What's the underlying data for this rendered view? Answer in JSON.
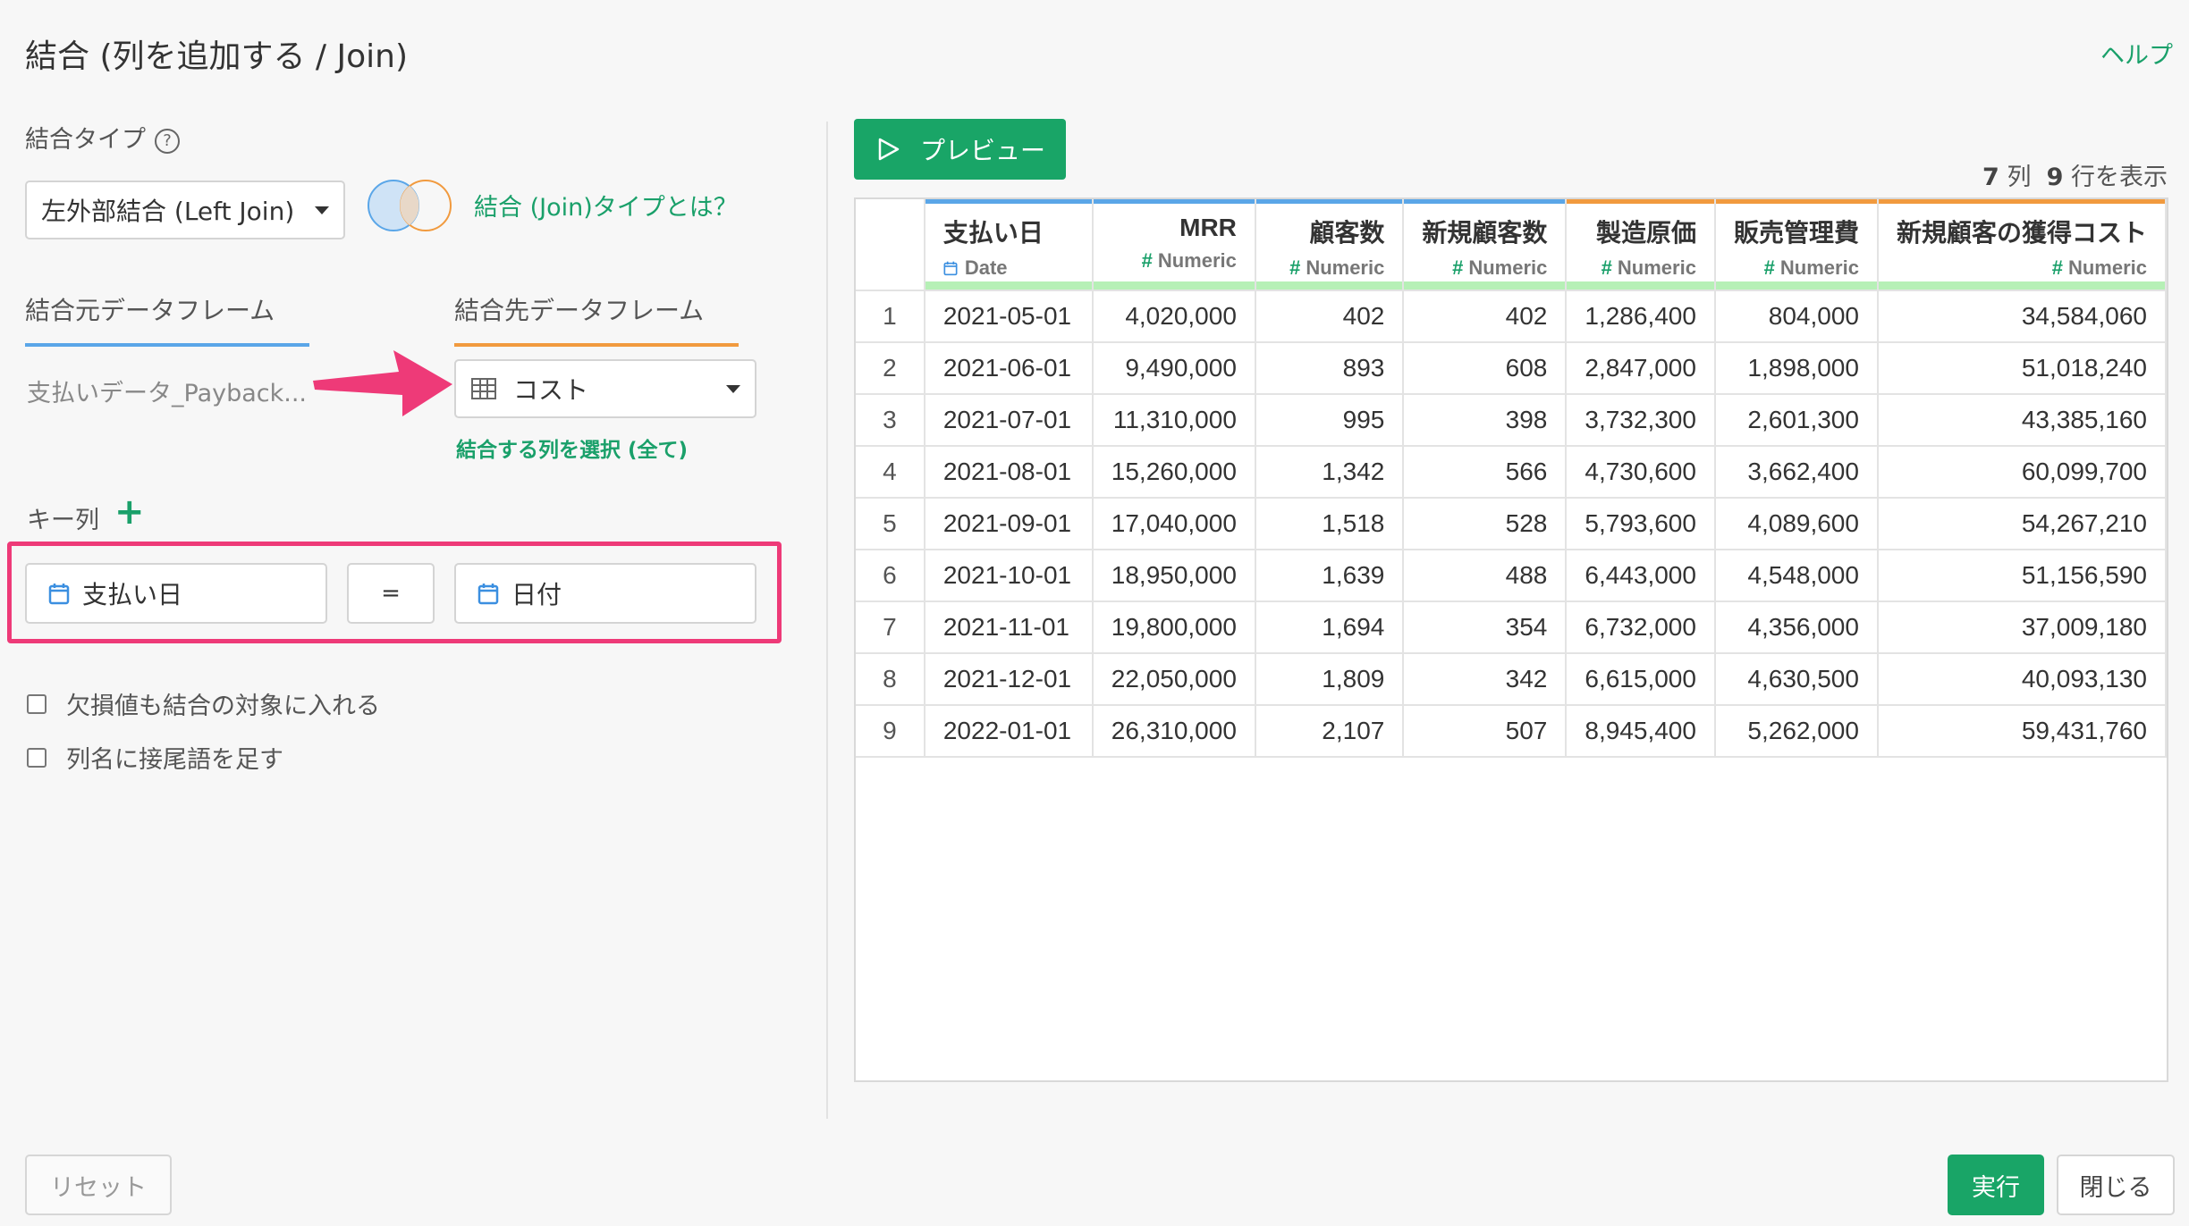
{
  "dialog": {
    "title": "結合 (列を追加する / Join)",
    "help": "ヘルプ"
  },
  "join_type": {
    "label": "結合タイプ",
    "help_icon": "?",
    "selected": "左外部結合 (Left Join)",
    "link": "結合 (Join)タイプとは？"
  },
  "source": {
    "label": "結合元データフレーム",
    "name": "支払いデータ_Payback..."
  },
  "target": {
    "label": "結合先データフレーム",
    "selected": "コスト",
    "column_link": "結合する列を選択 (全て)"
  },
  "keys": {
    "label": "キー列",
    "add": "+",
    "left": "支払い日",
    "operator": "=",
    "right": "日付"
  },
  "options": {
    "include_missing": "欠損値も結合の対象に入れる",
    "add_suffix": "列名に接尾語を足す"
  },
  "preview": {
    "button": "プレビュー",
    "cols": "7",
    "cols_unit": "列",
    "rows": "9",
    "rows_unit": "行を表示"
  },
  "table": {
    "columns": [
      {
        "name": "支払い日",
        "type": "Date",
        "color": "#5aa6e8"
      },
      {
        "name": "MRR",
        "type": "Numeric",
        "color": "#5aa6e8"
      },
      {
        "name": "顧客数",
        "type": "Numeric",
        "color": "#5aa6e8"
      },
      {
        "name": "新規顧客数",
        "type": "Numeric",
        "color": "#5aa6e8"
      },
      {
        "name": "製造原価",
        "type": "Numeric",
        "color": "#f19a3e"
      },
      {
        "name": "販売管理費",
        "type": "Numeric",
        "color": "#f19a3e"
      },
      {
        "name": "新規顧客の獲得コスト",
        "type": "Numeric",
        "color": "#f19a3e"
      }
    ],
    "rows": [
      [
        "1",
        "2021-05-01",
        "4,020,000",
        "402",
        "402",
        "1,286,400",
        "804,000",
        "34,584,060"
      ],
      [
        "2",
        "2021-06-01",
        "9,490,000",
        "893",
        "608",
        "2,847,000",
        "1,898,000",
        "51,018,240"
      ],
      [
        "3",
        "2021-07-01",
        "11,310,000",
        "995",
        "398",
        "3,732,300",
        "2,601,300",
        "43,385,160"
      ],
      [
        "4",
        "2021-08-01",
        "15,260,000",
        "1,342",
        "566",
        "4,730,600",
        "3,662,400",
        "60,099,700"
      ],
      [
        "5",
        "2021-09-01",
        "17,040,000",
        "1,518",
        "528",
        "5,793,600",
        "4,089,600",
        "54,267,210"
      ],
      [
        "6",
        "2021-10-01",
        "18,950,000",
        "1,639",
        "488",
        "6,443,000",
        "4,548,000",
        "51,156,590"
      ],
      [
        "7",
        "2021-11-01",
        "19,800,000",
        "1,694",
        "354",
        "6,732,000",
        "4,356,000",
        "37,009,180"
      ],
      [
        "8",
        "2021-12-01",
        "22,050,000",
        "1,809",
        "342",
        "6,615,000",
        "4,630,500",
        "40,093,130"
      ],
      [
        "9",
        "2022-01-01",
        "26,310,000",
        "2,107",
        "507",
        "8,945,400",
        "5,262,000",
        "59,431,760"
      ]
    ]
  },
  "footer": {
    "reset": "リセット",
    "run": "実行",
    "close": "閉じる"
  }
}
